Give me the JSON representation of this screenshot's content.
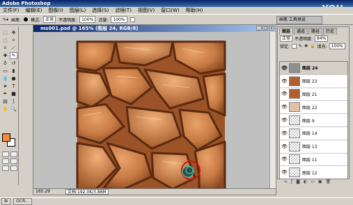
{
  "app_title": "Adobe Photoshop",
  "watermark": "YOU",
  "watermark_sub": "com",
  "menu": [
    "文件(F)",
    "编辑(E)",
    "图像(I)",
    "图层(L)",
    "选择(S)",
    "滤镜(T)",
    "视图(V)",
    "窗口(W)",
    "帮助(H)"
  ],
  "options": {
    "brush_label": "画笔:",
    "mode_label": "模式:",
    "mode_value": "正常",
    "opacity_label": "不透明度:",
    "opacity_value": "100%",
    "flow_label": "流量:",
    "flow_value": "100%",
    "tab_right": "画笔 工具预设"
  },
  "document": {
    "title": "ms001.psd @ 165% (图层 24, RGB/8)",
    "zoom": "165.29",
    "docinfo": "文档:192.0K/3.88M"
  },
  "layers_panel": {
    "tabs": [
      "图层",
      "通道",
      "路径",
      "历史"
    ],
    "blend_mode": "正常",
    "opacity_label": "不透明度:",
    "opacity_value": "84%",
    "lock_label": "锁定:",
    "fill_label": "填充:",
    "fill_value": "100%",
    "layers": [
      {
        "name": "图层 24",
        "thumb": "grey",
        "selected": true
      },
      {
        "name": "图层 23",
        "thumb": "tex",
        "selected": false
      },
      {
        "name": "图层 21",
        "thumb": "tex",
        "selected": false
      },
      {
        "name": "图层 22",
        "thumb": "solid",
        "selected": false
      },
      {
        "name": "图层 9",
        "thumb": "trans",
        "selected": false
      },
      {
        "name": "图层 14",
        "thumb": "trans",
        "selected": false
      },
      {
        "name": "图层 13",
        "thumb": "trans",
        "selected": false
      },
      {
        "name": "图层 11",
        "thumb": "trans",
        "selected": false
      },
      {
        "name": "图层 12",
        "thumb": "trans",
        "selected": false
      }
    ]
  },
  "taskbar": {
    "start": "⊞",
    "items": [
      "OCR..."
    ]
  },
  "colors": {
    "foreground": "#f08b3c",
    "background": "#ffffff",
    "canvas_base": "#b86a38"
  }
}
